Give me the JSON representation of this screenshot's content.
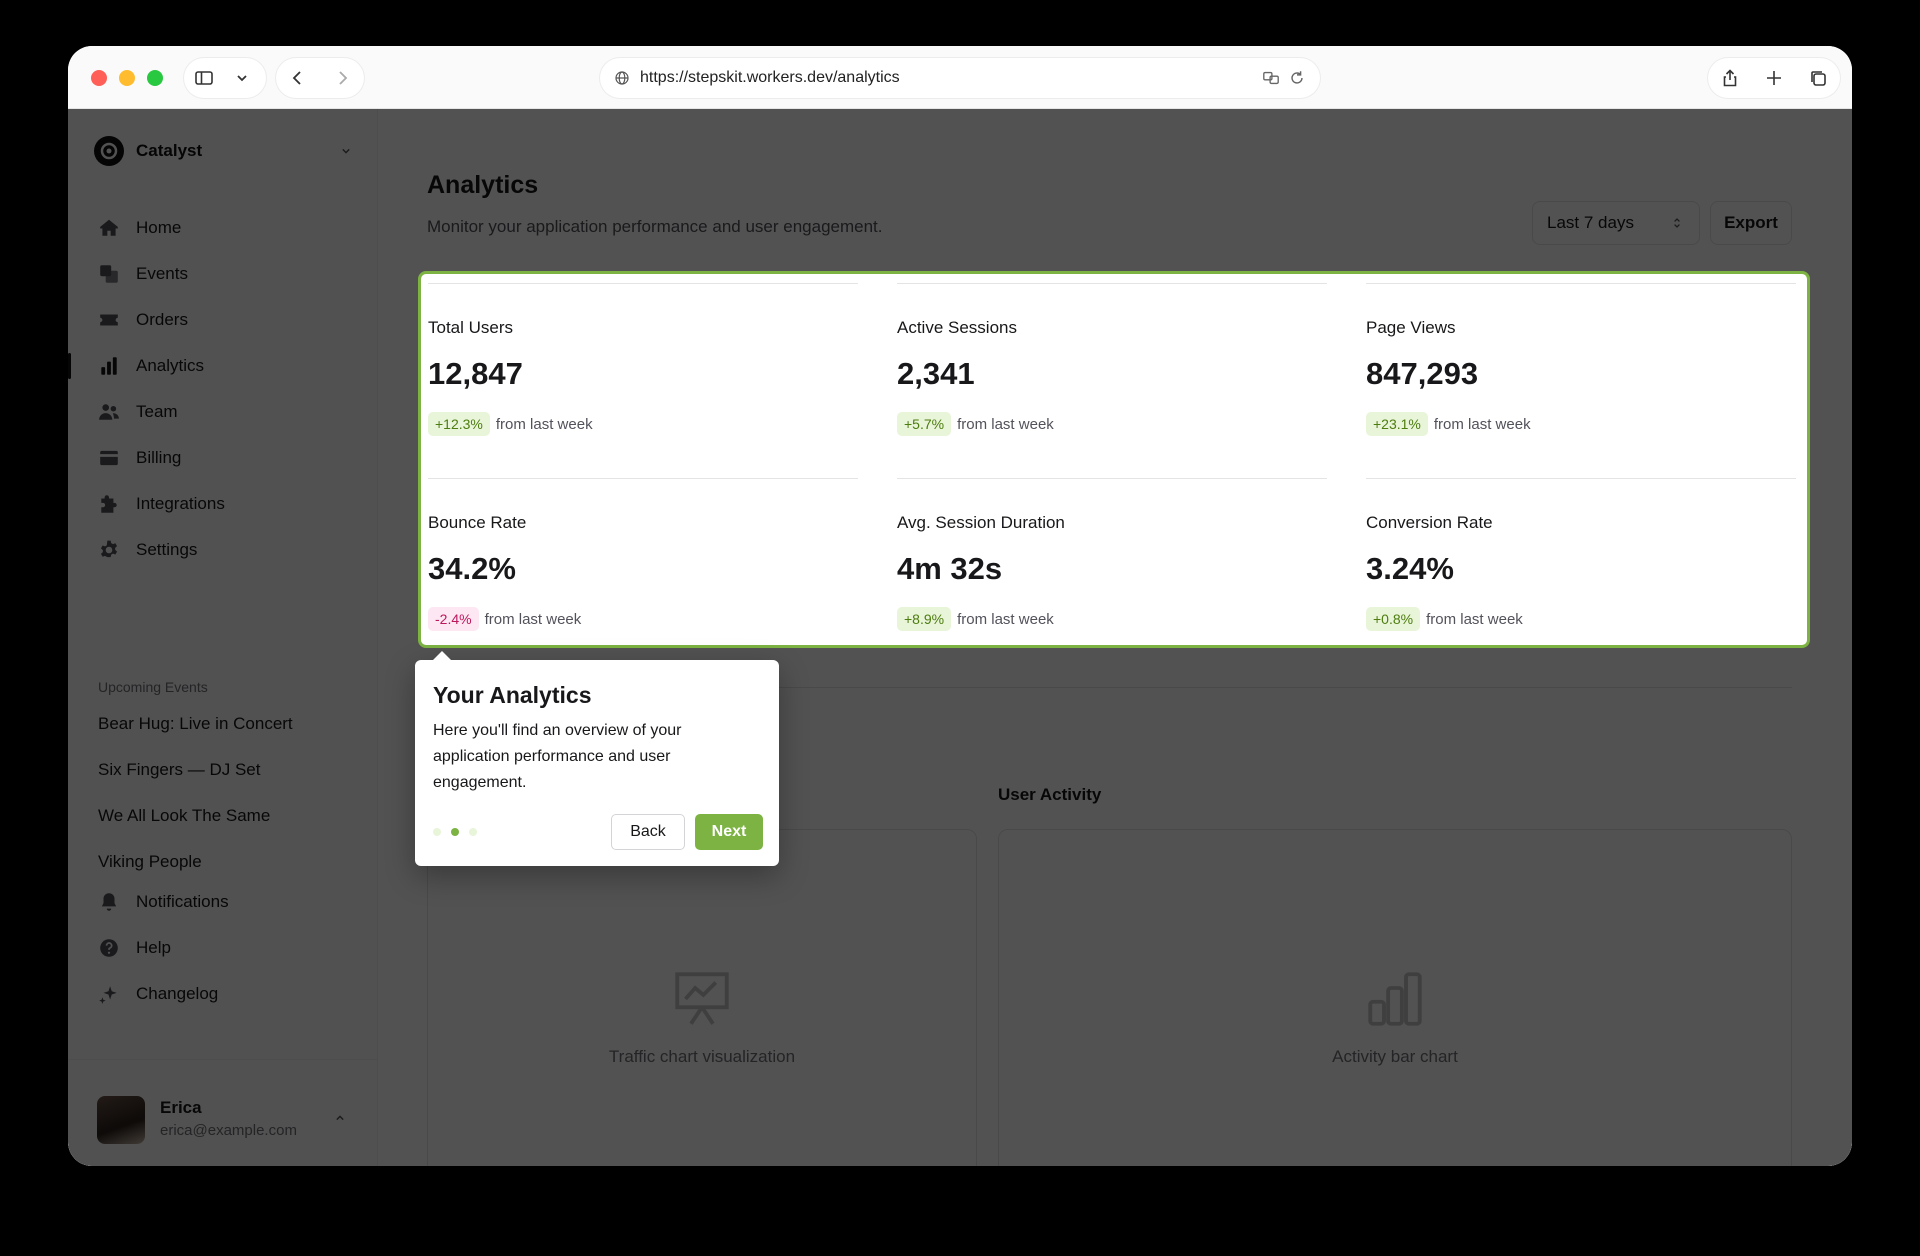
{
  "browser": {
    "url": "https://stepskit.workers.dev/analytics"
  },
  "sidebar": {
    "brand": "Catalyst",
    "items": [
      {
        "label": "Home",
        "icon": "home-icon"
      },
      {
        "label": "Events",
        "icon": "events-icon"
      },
      {
        "label": "Orders",
        "icon": "ticket-icon"
      },
      {
        "label": "Analytics",
        "icon": "bar-chart-icon",
        "active": true
      },
      {
        "label": "Team",
        "icon": "users-icon"
      },
      {
        "label": "Billing",
        "icon": "credit-card-icon"
      },
      {
        "label": "Integrations",
        "icon": "puzzle-icon"
      },
      {
        "label": "Settings",
        "icon": "gear-icon"
      }
    ],
    "upcoming_title": "Upcoming Events",
    "events": [
      "Bear Hug: Live in Concert",
      "Six Fingers — DJ Set",
      "We All Look The Same",
      "Viking People"
    ],
    "bottom_items": [
      {
        "label": "Notifications",
        "icon": "bell-icon"
      },
      {
        "label": "Help",
        "icon": "help-icon"
      },
      {
        "label": "Changelog",
        "icon": "sparkle-icon"
      }
    ],
    "user": {
      "name": "Erica",
      "email": "erica@example.com"
    }
  },
  "main": {
    "title": "Analytics",
    "subtitle": "Monitor your application performance and user engagement.",
    "range": "Last 7 days",
    "export": "Export",
    "stats": [
      {
        "label": "Total Users",
        "value": "12,847",
        "change": "+12.3%",
        "dir": "up",
        "note": "from last week"
      },
      {
        "label": "Active Sessions",
        "value": "2,341",
        "change": "+5.7%",
        "dir": "up",
        "note": "from last week"
      },
      {
        "label": "Page Views",
        "value": "847,293",
        "change": "+23.1%",
        "dir": "up",
        "note": "from last week"
      },
      {
        "label": "Bounce Rate",
        "value": "34.2%",
        "change": "-2.4%",
        "dir": "down",
        "note": "from last week"
      },
      {
        "label": "Avg. Session Duration",
        "value": "4m 32s",
        "change": "+8.9%",
        "dir": "up",
        "note": "from last week"
      },
      {
        "label": "Conversion Rate",
        "value": "3.24%",
        "change": "+0.8%",
        "dir": "up",
        "note": "from last week"
      }
    ],
    "charts": {
      "left": {
        "title": "",
        "placeholder": "Traffic chart visualization"
      },
      "right": {
        "title": "User Activity",
        "placeholder": "Activity bar chart"
      }
    }
  },
  "tour": {
    "title": "Your Analytics",
    "body": "Here you'll find an overview of your application performance  and user engagement.",
    "back": "Back",
    "next": "Next"
  },
  "colors": {
    "accent": "#7cb342"
  }
}
